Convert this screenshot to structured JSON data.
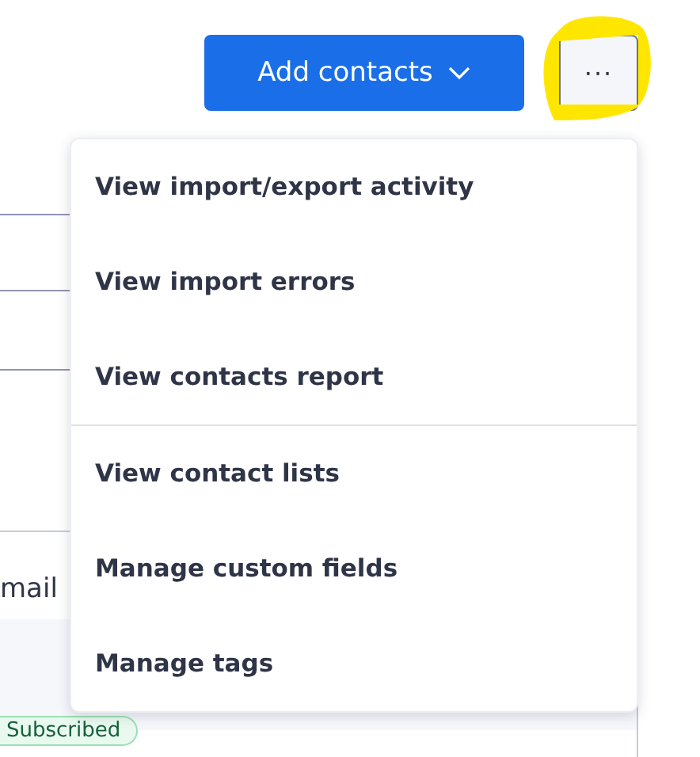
{
  "toolbar": {
    "add_button": {
      "label": "Add contacts"
    },
    "more_button": {
      "label": "···",
      "expanded": true
    }
  },
  "menu": {
    "sections": [
      [
        {
          "label": "View import/export activity"
        },
        {
          "label": "View import errors"
        },
        {
          "label": "View contacts report"
        }
      ],
      [
        {
          "label": "View contact lists"
        },
        {
          "label": "Manage custom fields"
        },
        {
          "label": "Manage tags"
        }
      ]
    ]
  },
  "table": {
    "header": "mail",
    "row": {
      "status": "Subscribed"
    }
  }
}
